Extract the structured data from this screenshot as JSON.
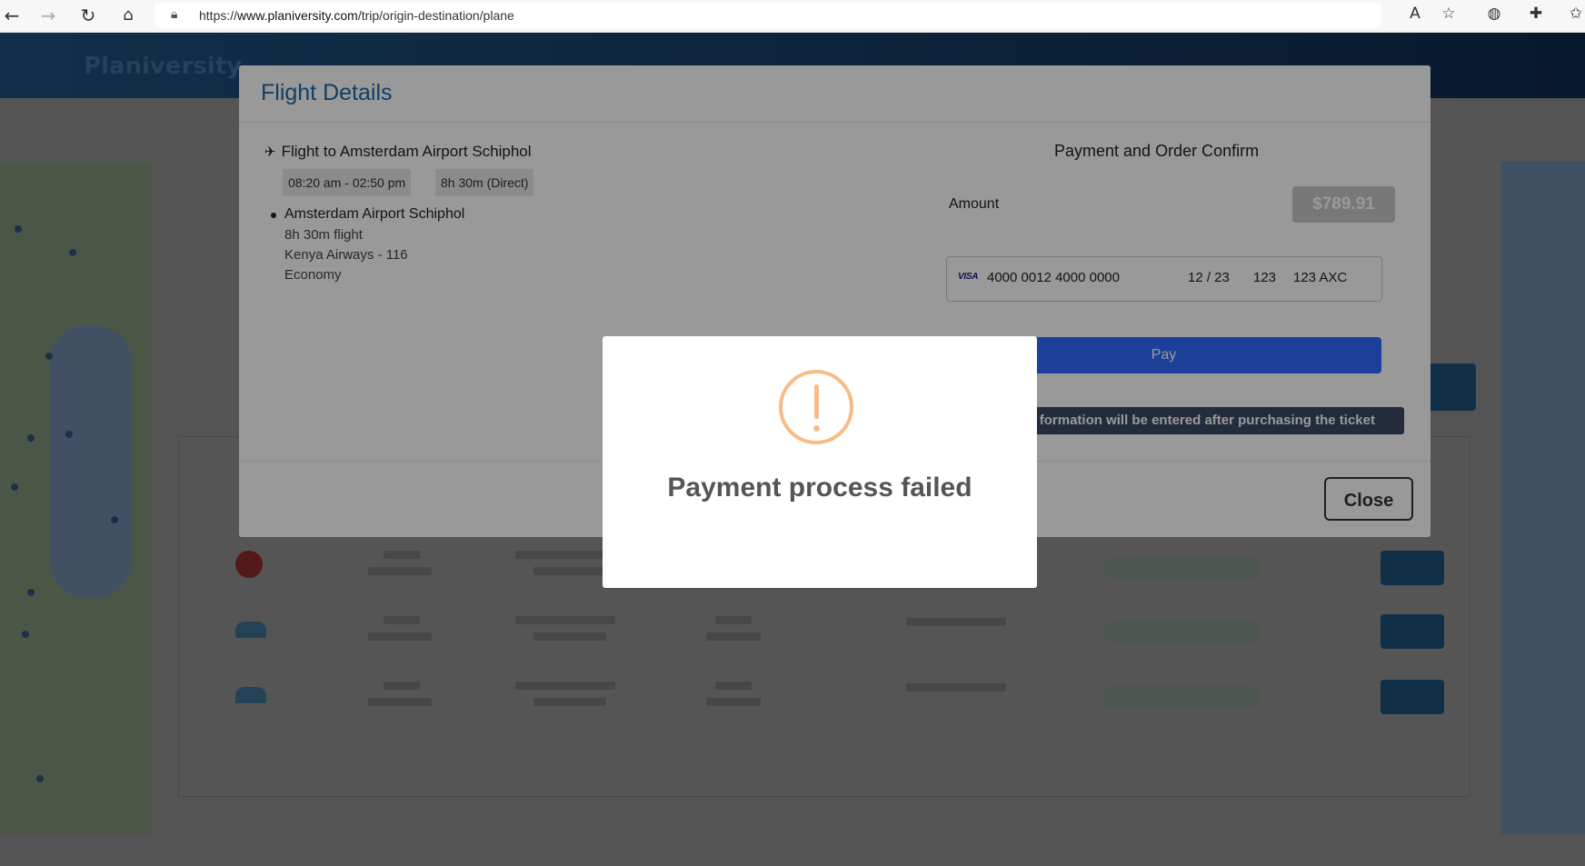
{
  "browser": {
    "url_prefix": "https://",
    "url_host": "www.planiversity.com",
    "url_path": "/trip/origin-destination/plane"
  },
  "page": {
    "logo_text": "Planiversity"
  },
  "modal": {
    "title": "Flight Details",
    "flight_title": "Flight to Amsterdam Airport Schiphol",
    "time_tag": "08:20 am - 02:50 pm",
    "duration_tag": "8h 30m (Direct)",
    "destination": "Amsterdam Airport Schiphol",
    "flight_length": "8h 30m flight",
    "airline": "Kenya Airways - 116",
    "cabin": "Economy",
    "payment_title": "Payment and Order Confirm",
    "amount_label": "Amount",
    "amount_value": "$789.91",
    "card": {
      "brand": "VISA",
      "number": "4000 0012 4000 0000",
      "expiry": "12 / 23",
      "cvc": "123",
      "zip": "123 AXC"
    },
    "pay_label": "Pay",
    "info_text": "formation will be entered after purchasing the ticket",
    "close_label": "Close"
  },
  "alert": {
    "icon": "warning-icon",
    "title": "Payment process failed",
    "accent_color": "#f8bb86"
  }
}
